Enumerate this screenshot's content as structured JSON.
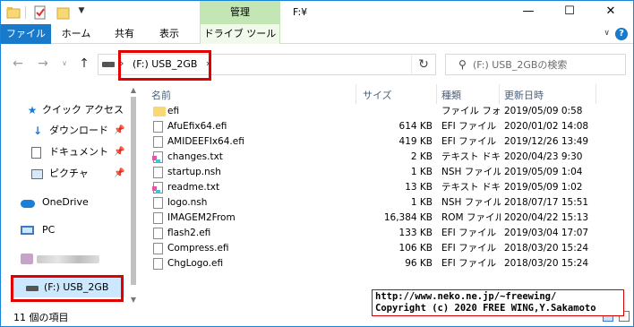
{
  "window": {
    "context_tab_header": "管理",
    "title": "F:¥",
    "minimize": "—",
    "maximize": "☐",
    "close": "✕"
  },
  "ribbon": {
    "tabs": [
      "ファイル",
      "ホーム",
      "共有",
      "表示",
      "ドライブ ツール"
    ]
  },
  "navigation": {
    "back": "←",
    "forward": "→",
    "recent": "∨",
    "up": "↑",
    "address": {
      "separator": "›",
      "crumb": "(F:) USB_2GB",
      "dropdown": "∨"
    },
    "refresh": "↻",
    "search": {
      "icon": "⚲",
      "placeholder": "(F:) USB_2GBの検索"
    }
  },
  "sidebar": {
    "items": [
      {
        "label": "クイック アクセス",
        "icon": "star-icon"
      },
      {
        "label": "ダウンロード",
        "icon": "download-icon",
        "pinned": true
      },
      {
        "label": "ドキュメント",
        "icon": "document-icon",
        "pinned": true
      },
      {
        "label": "ピクチャ",
        "icon": "pictures-icon",
        "pinned": true
      },
      {
        "label": "OneDrive",
        "icon": "cloud-icon"
      },
      {
        "label": "PC",
        "icon": "pc-icon"
      },
      {
        "label": "",
        "icon": "network-drive-icon"
      },
      {
        "label": "(F:) USB_2GB",
        "icon": "usb-drive-icon"
      }
    ]
  },
  "file_list": {
    "columns": [
      "名前",
      "サイズ",
      "種類",
      "更新日時"
    ],
    "rows": [
      {
        "name": "efi",
        "size": "",
        "type": "ファイル フォ...",
        "date": "2019/05/09 0:58",
        "icon": "folder"
      },
      {
        "name": "AfuEfix64.efi",
        "size": "614 KB",
        "type": "EFI ファイル",
        "date": "2020/01/02 14:08",
        "icon": "file"
      },
      {
        "name": "AMIDEEFIx64.efi",
        "size": "419 KB",
        "type": "EFI ファイル",
        "date": "2019/12/26 13:49",
        "icon": "file"
      },
      {
        "name": "changes.txt",
        "size": "2 KB",
        "type": "テキスト ドキ...",
        "date": "2020/04/23 9:30",
        "icon": "txt"
      },
      {
        "name": "startup.nsh",
        "size": "1 KB",
        "type": "NSH ファイル",
        "date": "2019/05/09 1:04",
        "icon": "file"
      },
      {
        "name": "readme.txt",
        "size": "13 KB",
        "type": "テキスト ドキ...",
        "date": "2019/05/09 1:02",
        "icon": "txt"
      },
      {
        "name": "logo.nsh",
        "size": "1 KB",
        "type": "NSH ファイル",
        "date": "2018/07/17 15:51",
        "icon": "file"
      },
      {
        "name": "IMAGEM2From",
        "size": "16,384 KB",
        "type": "ROM ファイル",
        "date": "2020/04/22 15:13",
        "icon": "file"
      },
      {
        "name": "flash2.efi",
        "size": "133 KB",
        "type": "EFI ファイル",
        "date": "2019/03/04 17:07",
        "icon": "file"
      },
      {
        "name": "Compress.efi",
        "size": "106 KB",
        "type": "EFI ファイル",
        "date": "2018/03/20 15:24",
        "icon": "file"
      },
      {
        "name": "ChgLogo.efi",
        "size": "96 KB",
        "type": "EFI ファイル",
        "date": "2018/03/20 15:24",
        "icon": "file"
      }
    ]
  },
  "status": {
    "item_count": "11 個の項目"
  },
  "overlay": {
    "url": "http://www.neko.ne.jp/~freewing/",
    "copyright": "Copyright (c) 2020 FREE WING,Y.Sakamoto"
  },
  "colors": {
    "accent": "#1979ca",
    "context_tab": "#c4e6b5",
    "selection": "#cce8ff",
    "highlight_box": "#e00000"
  }
}
